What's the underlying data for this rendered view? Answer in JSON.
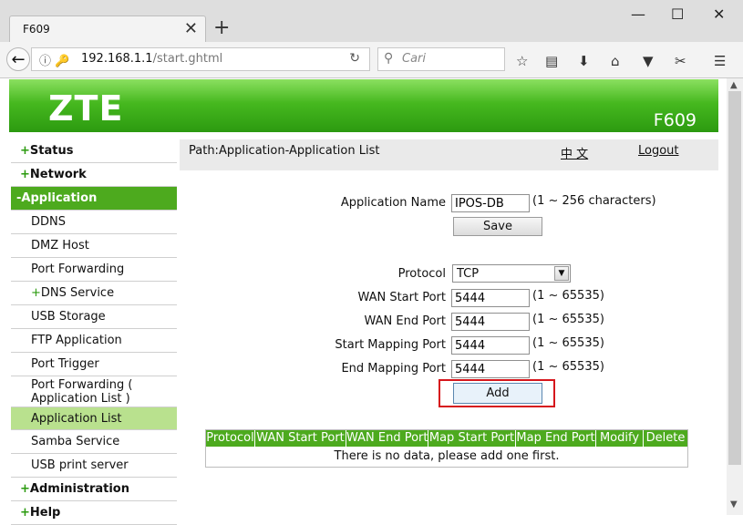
{
  "browser": {
    "tab_title": "F609",
    "tab_close": "✕",
    "new_tab": "+",
    "window_controls": {
      "minimize": "—",
      "maximize": "☐",
      "close": "✕"
    },
    "url_host": "192.168.1.1",
    "url_path": "/start.ghtml",
    "search_placeholder": "Cari",
    "icons": [
      "back-icon",
      "info-icon",
      "lock-icon",
      "reload-icon",
      "search-icon",
      "bookmark-star-icon",
      "reading-list-icon",
      "download-icon",
      "home-icon",
      "pocket-icon",
      "screenshot-icon",
      "menu-icon"
    ]
  },
  "header": {
    "logo": "ZTE",
    "model": "F609"
  },
  "sidebar": {
    "items": [
      {
        "label": "Status",
        "prefix": "+",
        "kind": "category"
      },
      {
        "label": "Network",
        "prefix": "+",
        "kind": "category"
      },
      {
        "label": "Application",
        "prefix": "-",
        "kind": "active-category"
      },
      {
        "label": "DDNS",
        "kind": "sub"
      },
      {
        "label": "DMZ Host",
        "kind": "sub"
      },
      {
        "label": "Port Forwarding",
        "kind": "sub"
      },
      {
        "label": "DNS Service",
        "prefix": "+",
        "kind": "sub"
      },
      {
        "label": "USB Storage",
        "kind": "sub"
      },
      {
        "label": "FTP Application",
        "kind": "sub"
      },
      {
        "label": "Port Trigger",
        "kind": "sub"
      },
      {
        "label": "Port Forwarding ( Application List )",
        "kind": "sub"
      },
      {
        "label": "Application List",
        "kind": "selected"
      },
      {
        "label": "Samba Service",
        "kind": "sub"
      },
      {
        "label": "USB print server",
        "kind": "sub"
      },
      {
        "label": "Administration",
        "prefix": "+",
        "kind": "category"
      },
      {
        "label": "Help",
        "prefix": "+",
        "kind": "category"
      }
    ]
  },
  "main": {
    "path": "Path:Application-Application List",
    "lang_link": "中 文",
    "logout": "Logout",
    "form": {
      "app_name_label": "Application Name",
      "app_name_value": "IPOS-DB",
      "app_name_hint": "(1 ~ 256 characters)",
      "save_label": "Save",
      "protocol_label": "Protocol",
      "protocol_value": "TCP",
      "wan_start_label": "WAN Start Port",
      "wan_start_value": "5444",
      "wan_end_label": "WAN End Port",
      "wan_end_value": "5444",
      "map_start_label": "Start Mapping Port",
      "map_start_value": "5444",
      "map_end_label": "End Mapping Port",
      "map_end_value": "5444",
      "port_hint": "(1 ~ 65535)",
      "add_label": "Add"
    },
    "table": {
      "headers": [
        "Protocol",
        "WAN Start Port",
        "WAN End Port",
        "Map Start Port",
        "Map End Port",
        "Modify",
        "Delete"
      ],
      "empty_message": "There is no data, please add one first."
    }
  },
  "colors": {
    "brand_green": "#4daa1e",
    "selected_green": "#b9e18e",
    "highlight_red": "#d6161c"
  }
}
